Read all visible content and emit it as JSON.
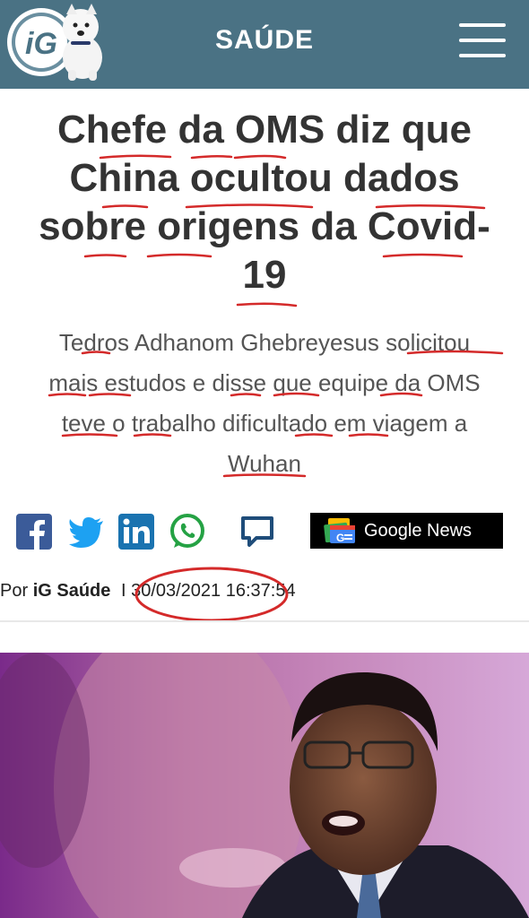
{
  "header": {
    "logo_text": "iG",
    "section": "SAÚDE"
  },
  "article": {
    "headline_lines": [
      "Chefe da OMS diz que",
      "China ocultou dados",
      "sobre origens da Covid-",
      "19"
    ],
    "subtitle_lines": [
      "Tedros Adhanom Ghebreyesus solicitou",
      "mais estudos e disse que equipe da OMS",
      "teve o trabalho dificultado em viagem a",
      "Wuhan"
    ],
    "byline_prefix": "Por",
    "author": "iG Saúde",
    "separator": "I",
    "timestamp": "30/03/2021 16:37:54"
  },
  "social": {
    "items": [
      "facebook-icon",
      "twitter-icon",
      "linkedin-icon",
      "whatsapp-icon",
      "comment-icon"
    ],
    "google_news_label": "Google News"
  },
  "colors": {
    "header_bg": "#4a7284",
    "headline": "#333333",
    "subtitle": "#555555",
    "annotation_red": "#d42a2a"
  }
}
